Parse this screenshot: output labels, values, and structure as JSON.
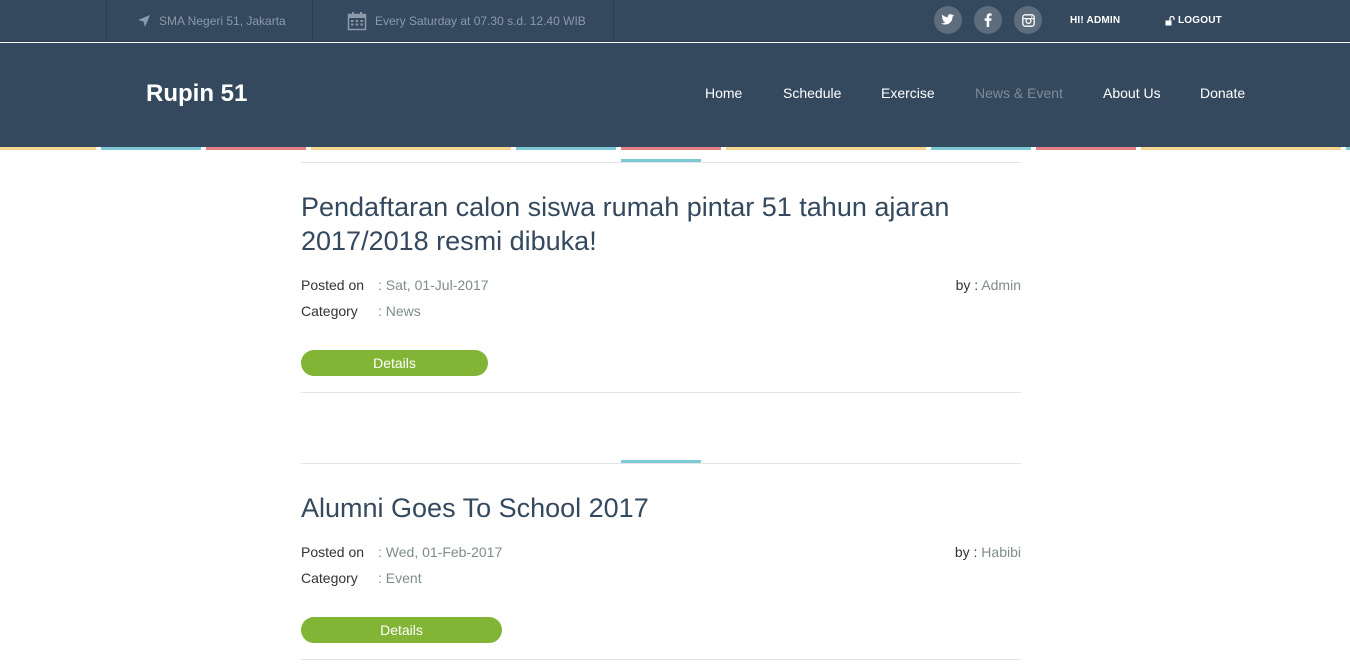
{
  "topbar": {
    "location": "SMA Negeri 51, Jakarta",
    "schedule": "Every Saturday at 07.30 s.d. 12.40 WIB",
    "social": [
      "twitter-icon",
      "facebook-icon",
      "instagram-icon"
    ],
    "user_link": "HI! ADMIN",
    "logout_link": "LOGOUT"
  },
  "header": {
    "brand": "Rupin 51",
    "nav": [
      {
        "label": "Home",
        "active": false
      },
      {
        "label": "Schedule",
        "active": false
      },
      {
        "label": "Exercise",
        "active": false
      },
      {
        "label": "News & Event",
        "active": true
      },
      {
        "label": "About Us",
        "active": false
      },
      {
        "label": "Donate",
        "active": false
      }
    ]
  },
  "colors": {
    "header_bg": "#34495e",
    "accent_teal": "#7dc9d6",
    "button_green": "#82b535",
    "stripe": [
      "#f5d58b",
      "#7dc9d6",
      "#e47f86"
    ]
  },
  "posts": [
    {
      "title": "Pendaftaran calon siswa rumah pintar 51 tahun ajaran 2017/2018 resmi dibuka!",
      "posted_label": "Posted on",
      "posted_value": ": Sat, 01-Jul-2017",
      "category_label": "Category",
      "category_value": ": News",
      "by_label": "by : ",
      "by_value": "Admin",
      "button": "Details"
    },
    {
      "title": "Alumni Goes To School 2017",
      "posted_label": "Posted on",
      "posted_value": ": Wed, 01-Feb-2017",
      "category_label": "Category",
      "category_value": ": Event",
      "by_label": "by : ",
      "by_value": "Habibi",
      "button": "Details"
    }
  ]
}
